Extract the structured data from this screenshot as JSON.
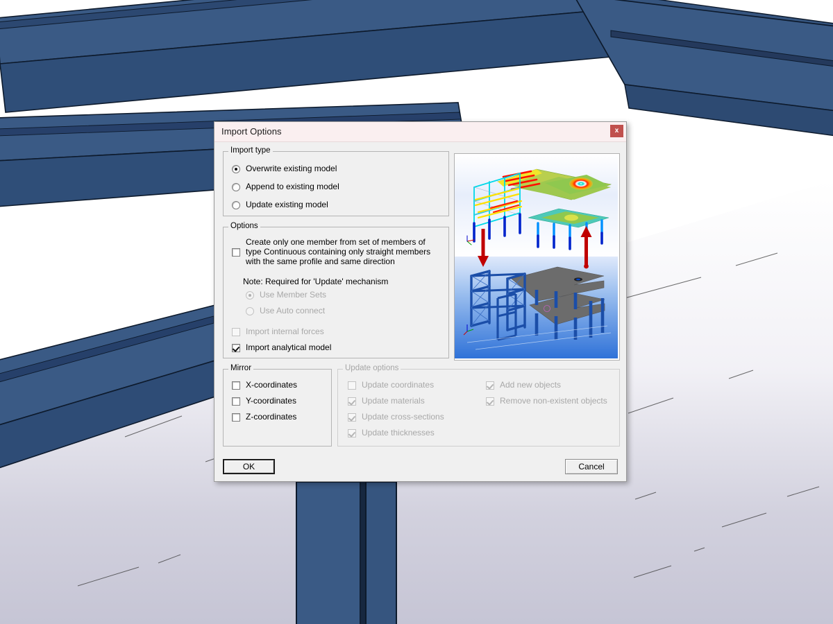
{
  "dialog": {
    "title": "Import Options",
    "close_label": "x",
    "close_icon": "close-icon",
    "accent_color": "#c0504d",
    "titlebar_color": "#faeff0",
    "face_color": "#f0f0f0"
  },
  "import_type": {
    "legend": "Import type",
    "options": [
      {
        "label": "Overwrite existing model",
        "selected": true,
        "enabled": true
      },
      {
        "label": "Append to existing model",
        "selected": false,
        "enabled": true
      },
      {
        "label": "Update existing model",
        "selected": false,
        "enabled": true
      }
    ]
  },
  "options": {
    "legend": "Options",
    "create_one_member": {
      "label": "Create only one member from set of members of type Continuous containing only straight members with the same profile and same direction",
      "checked": false,
      "enabled": true
    },
    "note": "Note: Required for 'Update' mechanism",
    "radios": [
      {
        "label": "Use Member Sets",
        "selected": true,
        "enabled": false
      },
      {
        "label": "Use Auto connect",
        "selected": false,
        "enabled": false
      }
    ],
    "checks": [
      {
        "label": "Import internal forces",
        "checked": false,
        "enabled": false
      },
      {
        "label": "Import analytical model",
        "checked": true,
        "enabled": true
      }
    ]
  },
  "mirror": {
    "legend": "Mirror",
    "items": [
      {
        "label": "X-coordinates",
        "checked": false,
        "enabled": true
      },
      {
        "label": "Y-coordinates",
        "checked": false,
        "enabled": true
      },
      {
        "label": "Z-coordinates",
        "checked": false,
        "enabled": true
      }
    ]
  },
  "update_options": {
    "legend": "Update options",
    "enabled": false,
    "left": [
      {
        "label": "Update coordinates",
        "checked": false,
        "enabled": false
      },
      {
        "label": "Update materials",
        "checked": true,
        "enabled": false
      },
      {
        "label": "Update cross-sections",
        "checked": true,
        "enabled": false
      },
      {
        "label": "Update thicknesses",
        "checked": true,
        "enabled": false
      }
    ],
    "right": [
      {
        "label": "Add new objects",
        "checked": true,
        "enabled": false
      },
      {
        "label": "Remove non-existent objects",
        "checked": true,
        "enabled": false
      }
    ]
  },
  "buttons": {
    "ok": "OK",
    "cancel": "Cancel"
  },
  "preview": {
    "description": "Structural model import preview: colored finite-element result model above, blue structural model with gray slabs below, connected by red transfer arrows",
    "top_model_colors": [
      "#ff0000",
      "#ffee00",
      "#8cc63f",
      "#00e5d0",
      "#00b7ff",
      "#0030cc"
    ],
    "bottom_model_color": "#1b4ea8",
    "slab_color": "#6b6b6b",
    "arrow_color": "#c00000",
    "sky_color": "#2f72d8"
  },
  "background": {
    "description": "3D viewport showing dark blue steel beams and column of a structural frame over a light gray-lavender floor",
    "beam_color": "#36557f",
    "beam_color_dark": "#2d4a72",
    "beam_edge": "#0c1828",
    "floor_top": "#ffffff",
    "floor_bottom": "#c7c6d6"
  }
}
